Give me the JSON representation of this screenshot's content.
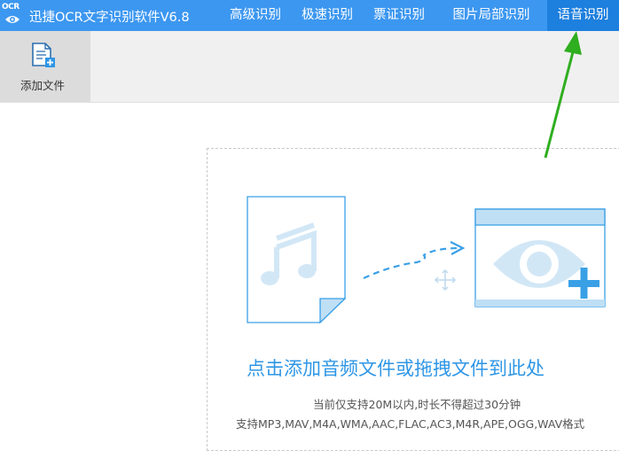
{
  "app": {
    "logo_text": "OCR",
    "title": "迅捷OCR文字识别软件V6.8"
  },
  "nav": {
    "tabs": [
      {
        "label": "高级识别"
      },
      {
        "label": "极速识别"
      },
      {
        "label": "票证识别"
      },
      {
        "label": "图片局部识别"
      },
      {
        "label": "语音识别",
        "active": true
      }
    ]
  },
  "toolbar": {
    "add_file_label": "添加文件",
    "add_file_icon": "document-add-icon"
  },
  "drop_zone": {
    "title": "点击添加音频文件或拖拽文件到此处",
    "note_size": "当前仅支持20M以内,时长不得超过30分钟",
    "note_formats": "支持MP3,MAV,M4A,WMA,AAC,FLAC,AC3,M4R,APE,OGG,WAV格式",
    "icons": [
      "music-file-icon",
      "drag-arrow-icon",
      "move-cursor-icon",
      "recognition-window-icon"
    ]
  },
  "colors": {
    "titlebar": "#3c97f0",
    "active_tab": "#1d7fde",
    "accent": "#2e96e6",
    "annotation_arrow": "#2fae1f"
  }
}
